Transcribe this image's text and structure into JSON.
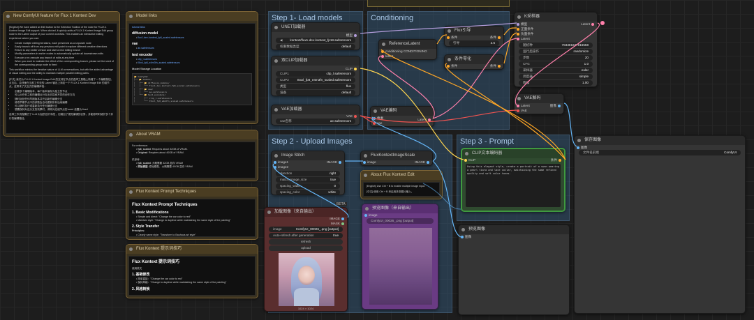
{
  "groups": {
    "load_models": "Step 1- Load models",
    "conditioning": "Conditioning",
    "upload_images": "Step 2 - Upload Images",
    "prompt": "Step 3 - Prompt"
  },
  "notes": {
    "main": {
      "title": "New ComfyUI feature for Flux 1 Kontext Dev",
      "p1": "[English] We have added an Edit button to the Selection Toolbox of the node for FLUX.1 Kontext Image Edit support. When clicked, it quickly adds a FLUX.1 Kontext Image Edit group node to the Latent output of your current workflow. This enables an interactive editing experience where you can:",
      "bullets": [
        "Create multiple editing iterations, each preserved as a separate node",
        "Easily branch off from any previous edit point to explore different creative directions",
        "Return to any earlier version and start a new editing branch",
        "Modify parameters in earlier nodes to automatically update all downstream edits",
        "Execute or re-execute any branch of edits at any time",
        "When you want to maintain the effect of the corresponding branch, please set the seed of the corresponding group node to fixed"
      ],
      "p2": "This workflow mimics the iterative nature of LLM conversations, but with the added advantage of visual editing and the ability to maintain multiple parallel editing paths.",
      "p3": "[中文] 我们为 FLUX.1 Kontext Image Edit 的支持在节点的选择工具箱上新增了一个编辑按钮。点击后，会快速在当前工作流的 Latent 输出上添加一个 FLUX.1 Kontext Image Edit 的组节点。这带来了交互式的编辑体验：",
      "bullets_cn": [
        "创建多个编辑版本，每个版本保存为独立的节点",
        "可以从任何之前的编辑点分支出去探索不同的创作方向",
        "随时返回任何早期版本并开启新的编辑分支",
        "修改早期节点中的参数会自动更新所有后续编辑",
        "可以随时执行或重新执行任何编辑分支",
        "想要保持对应分支的效果时，请将对应组节点的 seed 设置为 fixed"
      ],
      "p4": "这种工作流程模仿了 LLM 对话的迭代特性，但增加了视觉编辑的优势，并能够同时维护多个并行的编辑路径。"
    },
    "model_links": {
      "title": "Model links",
      "l1": "tutorial links",
      "h_diff": "diffusion model",
      "f_diff": "flux1-dev-kontext_fp8_scaled.safetensors",
      "h_vae": "vae",
      "f_vae": "ae.safetensors",
      "h_text": "text encoder",
      "f_clip1": "clip_l.safetensors",
      "f_clip2": "t5xxl_fp8_e4m3fn_scaled.safetensors",
      "h_loc": "Model Storage Location",
      "tree": "📂 ComfyUI/\n├── 📂 models/\n│   ├── 📂 diffusion_models/\n│   │   └── flux1-dev-kontext_fp8_scaled.safetensors\n│   ├── 📂 vae/\n│   │   └── ae.safetensors\n│   └── 📂 text_encoders/\n│       ├── clip_l.safetensors\n│       └── t5xxl_fp8_e4m3fn_scaled.safetensors"
    },
    "vram": {
      "title": "About VRAM",
      "h_en": "For reference:",
      "en1_k": "fp8_scaled",
      "en1_v": ": Requires about 32GB of VRAM.",
      "en2_k": "Original",
      "en2_v": ": Requires about 40GB of VRAM.",
      "h_cn": "供参考：",
      "cn1_k": "fp8_scaled",
      "cn1_v": ": 大概需要 32GB 显存 VRAM",
      "cn2_k": "原始模型",
      "cn2_v": ": 原始模型，大概需要 40GB 显存 VRAM"
    },
    "prompt_en": {
      "title": "Flux Kontext Prompt Techniques",
      "h": "Flux Kontext Prompt Techniques",
      "s1": "1. Basic Modifications",
      "b1": "Simple and direct: \"Change the car color to red\"",
      "b2": "Maintain style: \"Change to daytime while maintaining the same style of the painting\"",
      "s2": "2. Style Transfer",
      "s2b": "Principles:",
      "b3": "Clearly name style: \"Transform to Bauhaus art style\""
    },
    "prompt_cn": {
      "title": "Flux Kontext 提示词技巧",
      "h": "Flux Kontext 提示词技巧",
      "s0": "使用英文",
      "s1": "1. 基础修改",
      "b1": "简单直接：\"Change the car color to red\"",
      "b2": "保持风格：\"Change to daytime while maintaining the same style of the painting\"",
      "s2": "2. 风格转换"
    },
    "kontext_edit": {
      "title": "About Flux Kontext Edit",
      "en": "[English] Use Ctrl + B to enable multiple image input.",
      "cn": "[中文] 使用 Ctrl + B 来启用多张图片输入。"
    }
  },
  "nodes": {
    "unet": {
      "title": "UNET加载器",
      "out": "模型",
      "w1_l": "◀",
      "w1_v": "kontext/flux1-dev-kontext_fp18.safetensors",
      "w2_l": "权重数据类型",
      "w2_v": "default"
    },
    "dualclip": {
      "title": "双CLIP加载器",
      "out": "CLIP",
      "w1_l": "CLIP1",
      "w1_v": "clip_l.safetensors",
      "w2_l": "CLIP2",
      "w2_v": "t5xxl_fp8_e4m3fn_scaled.safetensors",
      "w3_l": "类型",
      "w3_v": "flux",
      "w4_l": "设备",
      "w4_v": "default"
    },
    "vae_loader": {
      "title": "VAE加载器",
      "out": "VAE",
      "w1_l": "vae名称",
      "w1_v": "ae.safetensors"
    },
    "vae_encode": {
      "title": "VAE编码",
      "in1": "像素",
      "in2": "vae",
      "out": "Latent"
    },
    "ref_latent": {
      "title": "ReferenceLatent",
      "in1": "conditioning",
      "in1_v": "CONDITIONING",
      "in2": "latent"
    },
    "flux_guide": {
      "title": "Flux引导",
      "in1": "条件",
      "out": "条件",
      "w1_l": "引导",
      "w1_v": "2.5"
    },
    "cond_zero": {
      "title": "条件零化",
      "in1": "条件",
      "out": "条件"
    },
    "ksampler": {
      "title": "K采样器",
      "in1": "模型",
      "in2": "正面条件",
      "in3": "负面条件",
      "in4": "Latent",
      "out": "Latent",
      "w1_l": "随机种",
      "w1_v": "784381637916558",
      "w2_l": "运行后操作",
      "w2_v": "randomize",
      "w3_l": "步数",
      "w3_v": "20",
      "w4_l": "CFG",
      "w4_v": "1.0",
      "w5_l": "采样器",
      "w5_v": "euler",
      "w6_l": "调度器",
      "w6_v": "simple",
      "w7_l": "降噪",
      "w7_v": "1.00"
    },
    "vae_decode": {
      "title": "VAE解码",
      "in1": "Latent",
      "in2": "VAE",
      "out": "图像"
    },
    "save_image": {
      "title": "保存图像",
      "in1": "图像",
      "w1_l": "文件名前缀",
      "w1_v": "ComfyUI"
    },
    "image_stitch": {
      "title": "Image Stitch",
      "in1": "image1",
      "in2": "image2",
      "out": "IMAGE",
      "w1_l": "direction",
      "w1_v": "right",
      "w2_l": "match_image_size",
      "w2_v": "true",
      "w3_l": "spacing_width",
      "w3_v": "0",
      "w4_l": "spacing_color",
      "w4_v": "white"
    },
    "image_scale": {
      "title": "FluxKontextImageScale",
      "in1": "image",
      "out": "IMAGE"
    },
    "load_image": {
      "title": "加载图像（来自输出）",
      "out1": "IMAGE",
      "out2": "MASK",
      "w1_l": "image",
      "w1_v": "ComfyUI_00026_.png [output]",
      "w2_l": "Auto-refresh after generation",
      "w2_v": "true",
      "b1": "refresh",
      "b2": "upload",
      "caption": "1024 × 1024"
    },
    "beta": "BETA",
    "preview2": {
      "title": "预览图像（来自输出）",
      "in1": "image",
      "w1_v": "ComfyUI_00026_.png [output]"
    },
    "clip_text": {
      "title": "CLIP文本编码器",
      "in1": "CLIP",
      "out": "条件",
      "text": "Using this elegant style, create a portrait of a swan wearing a pearl tiara and lace collar, maintaining the same refined quality and soft color tones."
    },
    "preview": {
      "title": "预览图像",
      "in1": "图像"
    }
  },
  "colors": {
    "model": "#b39ddb",
    "clip": "#ffd54f",
    "vae": "#ef5350",
    "cond": "#ffa726",
    "latent": "#ff80ab",
    "image": "#64b5f6"
  }
}
